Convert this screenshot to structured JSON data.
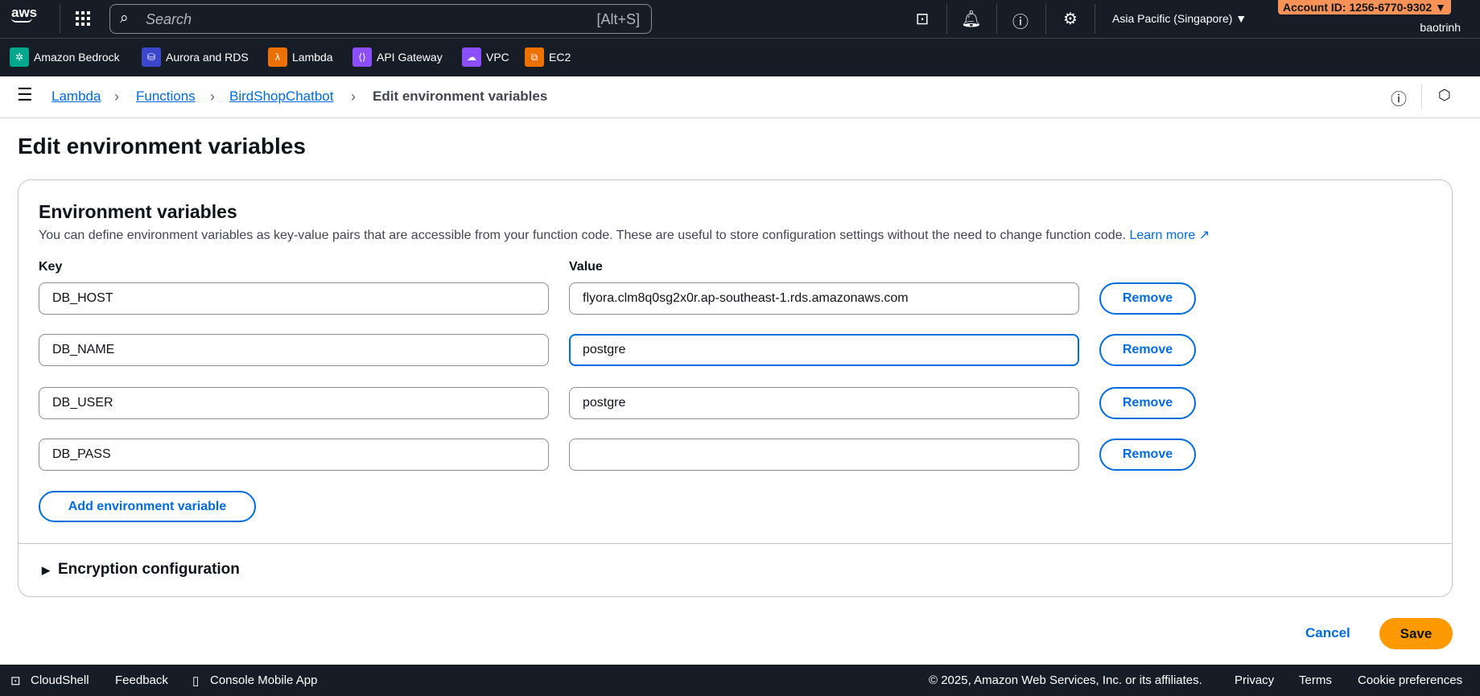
{
  "topbar": {
    "logo": "aws",
    "search_placeholder": "Search",
    "search_shortcut": "[Alt+S]",
    "region": "Asia Pacific (Singapore) ▼",
    "account": "Account ID: 1256-6770-9302 ▼",
    "user": "baotrinh"
  },
  "favorites": [
    {
      "label": "Amazon Bedrock",
      "color": "#01a88d"
    },
    {
      "label": "Aurora and RDS",
      "color": "#3b48cc"
    },
    {
      "label": "Lambda",
      "color": "#ed7100"
    },
    {
      "label": "API Gateway",
      "color": "#8c4fff"
    },
    {
      "label": "VPC",
      "color": "#8c4fff"
    },
    {
      "label": "EC2",
      "color": "#ed7100"
    }
  ],
  "breadcrumb": [
    "Lambda",
    "Functions",
    "BirdShopChatbot",
    "Edit environment variables"
  ],
  "page_title": "Edit environment variables",
  "env": {
    "title": "Environment variables",
    "description": "You can define environment variables as key-value pairs that are accessible from your function code. These are useful to store configuration settings without the need to change function code.",
    "learn_more": "Learn more",
    "key_label": "Key",
    "value_label": "Value",
    "rows": [
      {
        "key": "DB_HOST",
        "value": "flyora.clm8q0sg2x0r.ap-southeast-1.rds.amazonaws.com"
      },
      {
        "key": "DB_NAME",
        "value": "postgre"
      },
      {
        "key": "DB_USER",
        "value": "postgre"
      },
      {
        "key": "DB_PASS",
        "value": ""
      }
    ],
    "remove_label": "Remove",
    "add_label": "Add environment variable",
    "encryption": "Encryption configuration"
  },
  "actions": {
    "cancel": "Cancel",
    "save": "Save"
  },
  "footer": {
    "cloudshell": "CloudShell",
    "feedback": "Feedback",
    "mobile": "Console Mobile App",
    "copyright": "© 2025, Amazon Web Services, Inc. or its affiliates.",
    "privacy": "Privacy",
    "terms": "Terms",
    "cookies": "Cookie preferences"
  }
}
